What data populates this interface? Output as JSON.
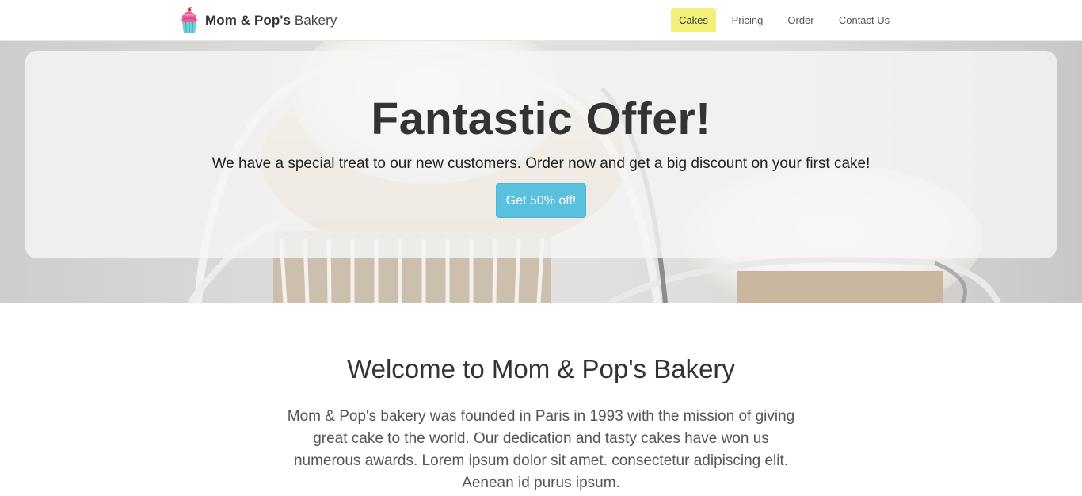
{
  "navbar": {
    "brand": {
      "logo_icon": "cupcake-icon",
      "name_bold": "Mom & Pop's",
      "name_light": "Bakery"
    },
    "links": [
      {
        "label": "Cakes",
        "active": true
      },
      {
        "label": "Pricing",
        "active": false
      },
      {
        "label": "Order",
        "active": false
      },
      {
        "label": "Contact Us",
        "active": false
      }
    ]
  },
  "hero": {
    "title": "Fantastic Offer!",
    "subtitle": "We have a special treat to our new customers. Order now and get a big discount on your first cake!",
    "button_label": "Get 50% off!"
  },
  "welcome": {
    "title": "Welcome to Mom & Pop's Bakery",
    "text": "Mom & Pop's bakery was founded in Paris in 1993 with the mission of giving great cake to the world. Our dedication and tasty cakes have won us numerous awards. Lorem ipsum dolor sit amet. consectetur adipiscing elit. Aenean id purus ipsum."
  },
  "colors": {
    "active_nav_bg": "#f2f07a",
    "button_bg": "#5bc0de",
    "logo_pink": "#e94b8a",
    "logo_cup": "#6fd0d8"
  }
}
